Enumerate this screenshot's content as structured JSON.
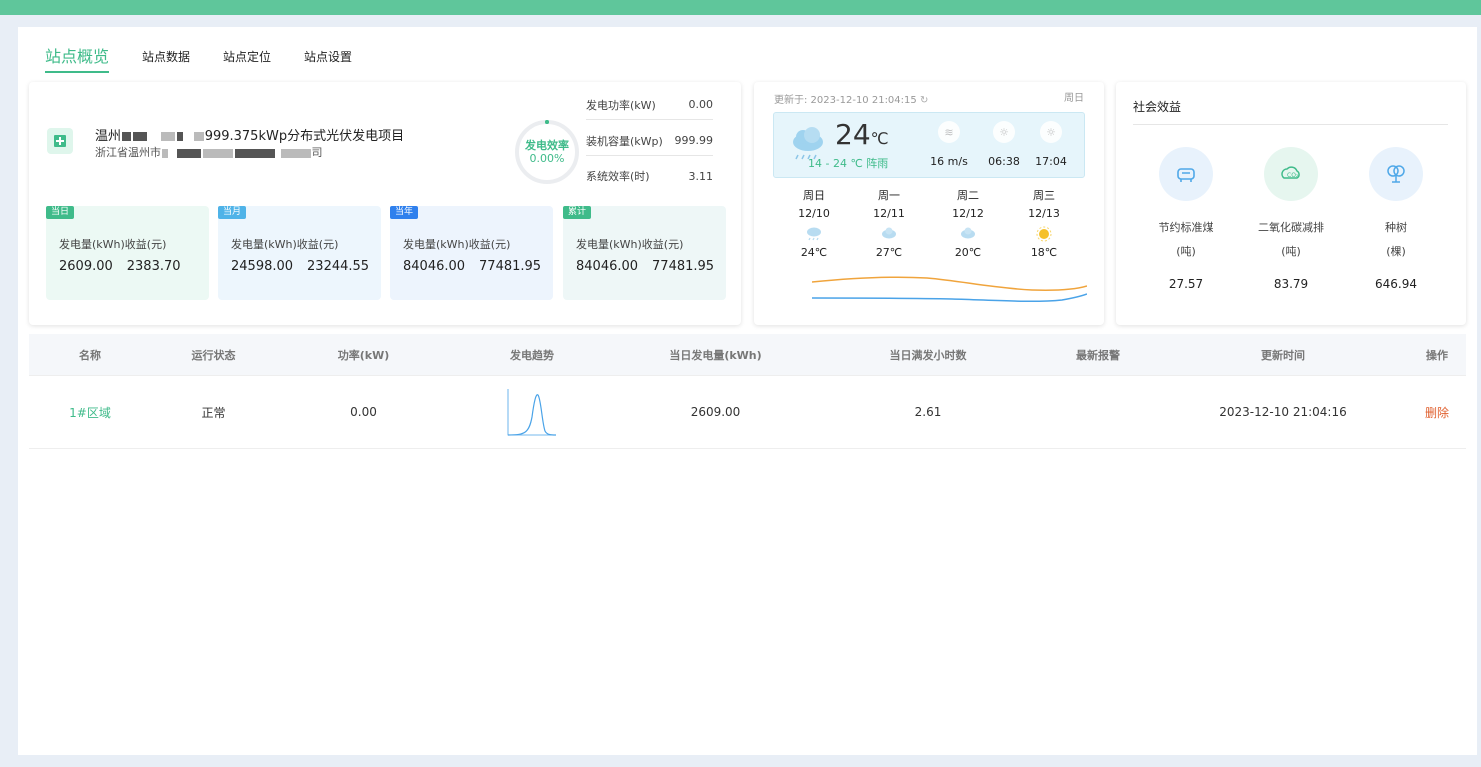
{
  "tabs": [
    "站点概览",
    "站点数据",
    "站点定位",
    "站点设置"
  ],
  "station": {
    "name_prefix": "温州",
    "name_suffix": "999.375kWp分布式光伏发电项目",
    "addr_prefix": "浙江省温州市",
    "addr_suffix": "司",
    "efficiency_label": "发电效率",
    "efficiency_value": "0.00%",
    "efficiency_fraction": 0.0,
    "metrics": [
      {
        "label": "发电功率(kW)",
        "value": "0.00"
      },
      {
        "label": "装机容量(kWp)",
        "value": "999.99"
      },
      {
        "label": "系统效率(时)",
        "value": "3.11"
      }
    ]
  },
  "stats": [
    {
      "badge": "当日",
      "label": "发电量(kWh)收益(元)",
      "gen": "2609.00",
      "income": "2383.70",
      "color": "#3fbb8a",
      "bg": "#ecf9f4"
    },
    {
      "badge": "当月",
      "label": "发电量(kWh)收益(元)",
      "gen": "24598.00",
      "income": "23244.55",
      "color": "#4fb3e8",
      "bg": "#edf6fd"
    },
    {
      "badge": "当年",
      "label": "发电量(kWh)收益(元)",
      "gen": "84046.00",
      "income": "77481.95",
      "color": "#2f80ed",
      "bg": "#edf4fd"
    },
    {
      "badge": "累计",
      "label": "发电量(kWh)收益(元)",
      "gen": "84046.00",
      "income": "77481.95",
      "color": "#3fbb8a",
      "bg": "#eef7f7"
    }
  ],
  "weather": {
    "updated": "更新于: 2023-12-10 21:04:15",
    "weekday": "周日",
    "temp": "24",
    "temp_unit": "℃",
    "range": "14 - 24 ℃ 阵雨",
    "wind": "16 m/s",
    "sunrise": "06:38",
    "sunset": "17:04",
    "forecast": [
      {
        "day": "周日",
        "date": "12/10",
        "temp": "24℃",
        "icon": "snow-cloud-icon"
      },
      {
        "day": "周一",
        "date": "12/11",
        "temp": "27℃",
        "icon": "cloud-icon"
      },
      {
        "day": "周二",
        "date": "12/12",
        "temp": "20℃",
        "icon": "cloud-icon"
      },
      {
        "day": "周三",
        "date": "12/13",
        "temp": "18℃",
        "icon": "sun-icon"
      }
    ],
    "high_color": "#f0a43c",
    "low_color": "#4aa3e8"
  },
  "social": {
    "title": "社会效益",
    "items": [
      {
        "name": "节约标准煤",
        "unit": "(吨)",
        "value": "27.57"
      },
      {
        "name": "二氧化碳减排",
        "unit": "(吨)",
        "value": "83.79"
      },
      {
        "name": "种树",
        "unit": "(棵)",
        "value": "646.94"
      }
    ]
  },
  "table": {
    "headers": [
      "名称",
      "运行状态",
      "功率(kW)",
      "发电趋势",
      "当日发电量(kWh)",
      "当日满发小时数",
      "最新报警",
      "更新时间",
      "操作"
    ],
    "rows": [
      {
        "name": "1#区域",
        "status": "正常",
        "power": "0.00",
        "daily_gen": "2609.00",
        "full_hours": "2.61",
        "alarm": "",
        "updated": "2023-12-10 21:04:16",
        "action": "删除"
      }
    ]
  },
  "colors": {
    "accent": "#3fbb8a",
    "danger": "#e0602f",
    "topbar": "#5fc69b"
  }
}
